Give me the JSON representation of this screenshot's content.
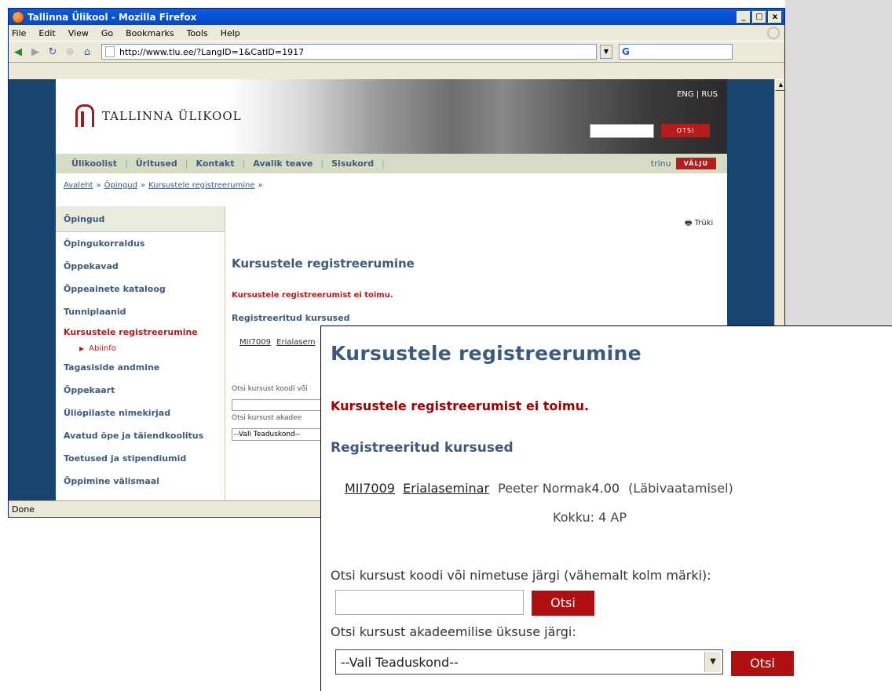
{
  "window": {
    "title": "Tallinna Ülikool - Mozilla Firefox",
    "btn_min": "_",
    "btn_max": "□",
    "btn_close": "x"
  },
  "menu": [
    "File",
    "Edit",
    "View",
    "Go",
    "Bookmarks",
    "Tools",
    "Help"
  ],
  "address": {
    "url": "http://www.tlu.ee/?LangID=1&CatID=1917"
  },
  "search_engine": {
    "label": "G"
  },
  "status": {
    "text": "Done"
  },
  "site": {
    "logo_text": "TALLINNA ÜLIKOOL",
    "lang_switch": "ENG | RUS",
    "header_search_button": "OTSI",
    "topnav": [
      "Ülikoolist",
      "Üritused",
      "Kontakt",
      "Avalik teave",
      "Sisukord"
    ],
    "user": "trinu",
    "logout": "VÄLJU",
    "breadcrumb": [
      "Avaleht",
      "Õpingud",
      "Kursustele registreerumine"
    ],
    "breadcrumb_sep": "»"
  },
  "leftnav": {
    "header": "Õpingud",
    "items": [
      "Õpingukorraldus",
      "Õppekavad",
      "Õppeainete kataloog",
      "Tunniplaanid",
      "Kursustele registreerumine",
      "Abiinfo",
      "Tagasiside andmine",
      "Õppekaart",
      "Üliõpilaste nimekirjad",
      "Avatud õpe ja täiendkoolitus",
      "Toetused ja stipendiumid",
      "Õppimine välismaal"
    ]
  },
  "main": {
    "print": "Trüki",
    "title": "Kursustele registreerumine",
    "notice": "Kursustele registreerumist ei toimu.",
    "registered_heading": "Registreeritud kursused",
    "course_code": "MII7009",
    "course_name_short": "Erialasem",
    "search1_short": "Otsi kursust koodi või",
    "search2_short": "Otsi kursust akadee",
    "select_short": "--Vali Teaduskond--"
  },
  "inset": {
    "title": "Kursustele registreerumine",
    "notice": "Kursustele registreerumist ei toimu.",
    "registered_heading": "Registreeritud kursused",
    "course": {
      "code": "MII7009",
      "name": "Erialaseminar",
      "teacher": "Peeter Normak",
      "credits": "4.00",
      "status": "(Läbivaatamisel)"
    },
    "total": "Kokku:  4 AP",
    "search_by_code_label": "Otsi kursust koodi või nimetuse järgi (vähemalt kolm märki):",
    "search_button": "Otsi",
    "search_by_unit_label": "Otsi kursust akadeemilise üksuse järgi:",
    "faculty_select": "--Vali Teaduskond--",
    "search_button2": "Otsi"
  }
}
